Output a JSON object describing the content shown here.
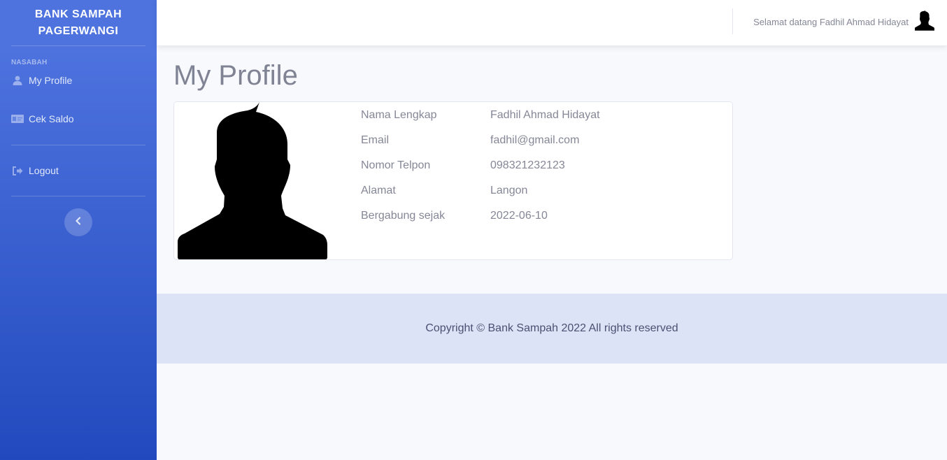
{
  "sidebar": {
    "brand": "BANK SAMPAH\nPAGERWANGI",
    "heading": "NASABAH",
    "items": [
      {
        "label": "My Profile",
        "icon": "user-icon"
      },
      {
        "label": "Cek Saldo",
        "icon": "id-card-icon"
      }
    ],
    "logout": {
      "label": "Logout",
      "icon": "sign-out-icon"
    },
    "toggle_icon": "chevron-left-icon"
  },
  "topbar": {
    "greeting": "Selamat datang Fadhil Ahmad Hidayat"
  },
  "main": {
    "title": "My Profile",
    "profile": [
      {
        "label": "Nama Lengkap",
        "value": "Fadhil Ahmad Hidayat"
      },
      {
        "label": "Email",
        "value": "fadhil@gmail.com"
      },
      {
        "label": "Nomor Telpon",
        "value": "098321232123"
      },
      {
        "label": "Alamat",
        "value": "Langon"
      },
      {
        "label": "Bergabung sejak",
        "value": "2022-06-10"
      }
    ]
  },
  "footer": {
    "text": "Copyright © Bank Sampah 2022 All rights reserved"
  },
  "colors": {
    "sidebar_top": "#4e73df",
    "sidebar_bottom": "#224abe",
    "footer_bg": "#dde3f6",
    "muted_text": "#858796"
  }
}
